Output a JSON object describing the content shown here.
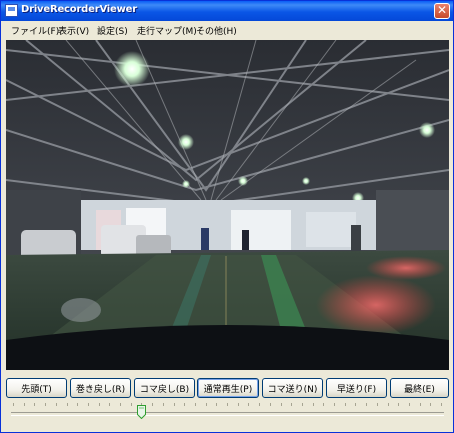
{
  "window": {
    "title": "DriveRecorderViewer",
    "close_glyph": "✕"
  },
  "menu": [
    {
      "label": "ファイル(F)"
    },
    {
      "label": "表示(V)"
    },
    {
      "label": "設定(S)"
    },
    {
      "label": "走行マップ(M)"
    },
    {
      "label": "その他(H)"
    }
  ],
  "controls": {
    "buttons": [
      {
        "label": "先頭(T)"
      },
      {
        "label": "巻き戻し(R)"
      },
      {
        "label": "コマ戻し(B)"
      },
      {
        "label": "通常再生(P)"
      },
      {
        "label": "コマ送り(N)"
      },
      {
        "label": "早送り(F)"
      },
      {
        "label": "最終(E)"
      }
    ],
    "seek_position_fraction": 0.3,
    "default_button": "通常再生(P)"
  },
  "icons": [
    "app-icon",
    "close-icon"
  ],
  "colors": {
    "titlebar": "#0a56e6",
    "window_bg": "#ece9d8",
    "button_border": "#003c74"
  }
}
